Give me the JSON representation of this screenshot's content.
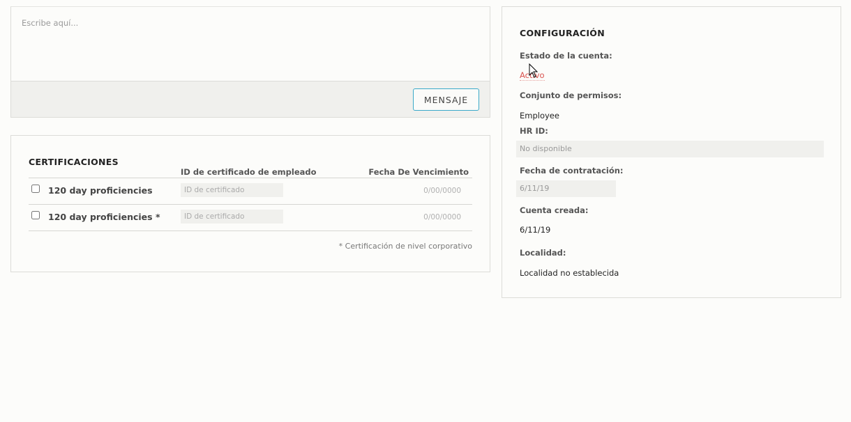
{
  "message": {
    "placeholder": "Escribe aquí...",
    "button_label": "MENSAJE"
  },
  "certifications": {
    "title": "CERTIFICACIONES",
    "columns": {
      "id": "ID de certificado de empleado",
      "expiry": "Fecha De Vencimiento"
    },
    "rows": [
      {
        "name": "120 day proficiencies",
        "id_placeholder": "ID de certificado",
        "expiry": "0/00/0000"
      },
      {
        "name": "120 day proficiencies *",
        "id_placeholder": "ID de certificado",
        "expiry": "0/00/0000"
      }
    ],
    "footnote": "* Certificación de nivel corporativo"
  },
  "configuration": {
    "title": "CONFIGURACIÓN",
    "account_status_label": "Estado de la cuenta:",
    "account_status_value": "Activo",
    "permission_set_label": "Conjunto de permisos:",
    "permission_set_value": "Employee",
    "hr_id_label": "HR ID:",
    "hr_id_value": "No disponible",
    "hire_date_label": "Fecha de contratación:",
    "hire_date_value": "6/11/19",
    "account_created_label": "Cuenta creada:",
    "account_created_value": "6/11/19",
    "location_label": "Localidad:",
    "location_value": "Localidad no establecida"
  },
  "colors": {
    "accent": "#3aa9c9",
    "status_active": "#d9534f"
  }
}
